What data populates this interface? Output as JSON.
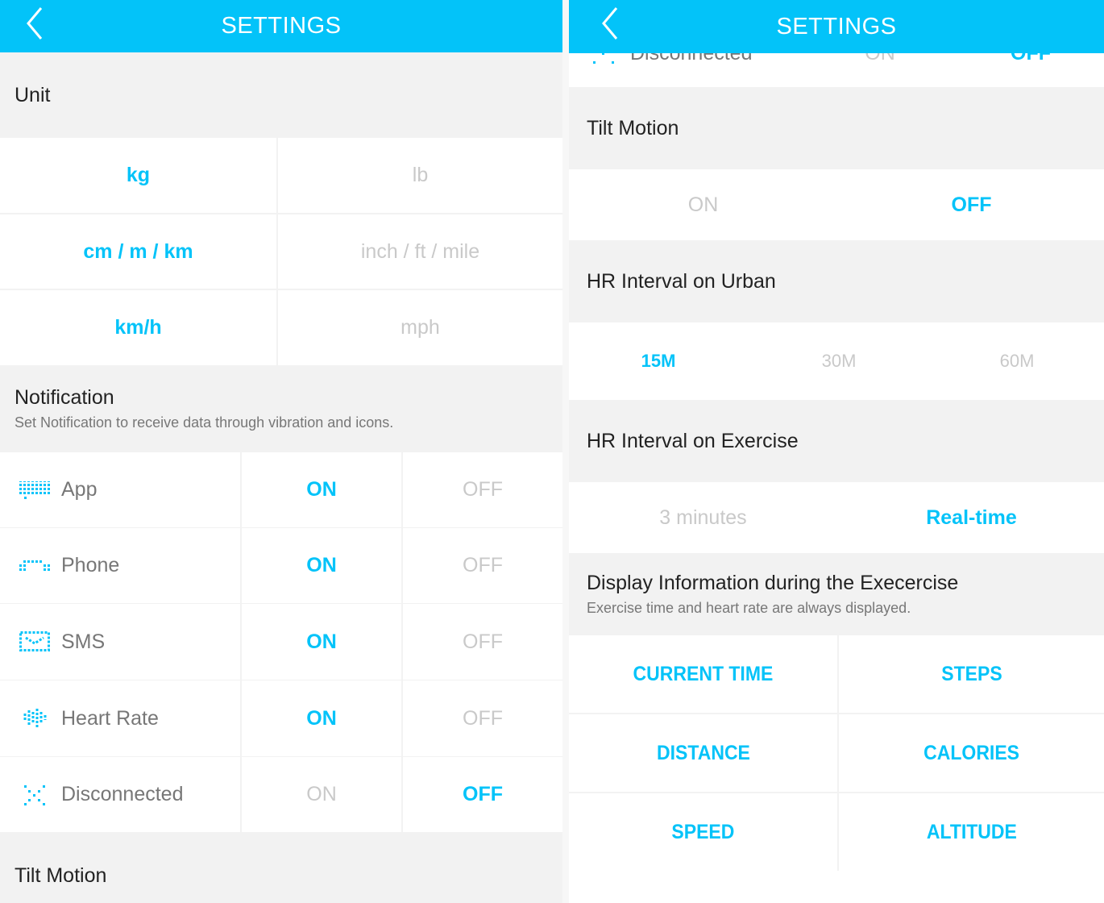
{
  "header": {
    "title": "SETTINGS",
    "back_icon": "chevron-left-icon"
  },
  "colors": {
    "accent": "#03c3f9",
    "inactive": "#c9c9c9",
    "section_bg": "#f2f2f2"
  },
  "left": {
    "unit": {
      "title": "Unit",
      "rows": [
        {
          "a": "kg",
          "b": "lb",
          "selected": "a"
        },
        {
          "a": "cm / m / km",
          "b": "inch / ft / mile",
          "selected": "a"
        },
        {
          "a": "km/h",
          "b": "mph",
          "selected": "a"
        }
      ]
    },
    "notification": {
      "title": "Notification",
      "subtitle": "Set Notification to receive data through vibration and icons.",
      "rows": [
        {
          "label": "App",
          "icon": "app-dot-icon",
          "on": "ON",
          "off": "OFF",
          "state": "on"
        },
        {
          "label": "Phone",
          "icon": "phone-dot-icon",
          "on": "ON",
          "off": "OFF",
          "state": "on"
        },
        {
          "label": "SMS",
          "icon": "sms-dot-icon",
          "on": "ON",
          "off": "OFF",
          "state": "on"
        },
        {
          "label": "Heart Rate",
          "icon": "heart-rate-dot-icon",
          "on": "ON",
          "off": "OFF",
          "state": "on"
        },
        {
          "label": "Disconnected",
          "icon": "disconnected-dot-icon",
          "on": "ON",
          "off": "OFF",
          "state": "off"
        }
      ]
    },
    "tilt_title": "Tilt Motion"
  },
  "right": {
    "partial_row": {
      "label": "Disconnected",
      "on": "ON",
      "off": "OFF",
      "state": "off"
    },
    "tilt": {
      "title": "Tilt Motion",
      "on": "ON",
      "off": "OFF",
      "state": "off"
    },
    "hr_urban": {
      "title": "HR Interval on Urban",
      "options": [
        "15M",
        "30M",
        "60M"
      ],
      "selected": "15M"
    },
    "hr_exercise": {
      "title": "HR Interval on Exercise",
      "options": [
        "3 minutes",
        "Real-time"
      ],
      "selected": "Real-time"
    },
    "display": {
      "title": "Display Information during the Execercise",
      "subtitle": "Exercise time and heart rate are always displayed.",
      "items": [
        "CURRENT TIME",
        "STEPS",
        "DISTANCE",
        "CALORIES",
        "SPEED",
        "ALTITUDE"
      ]
    }
  }
}
